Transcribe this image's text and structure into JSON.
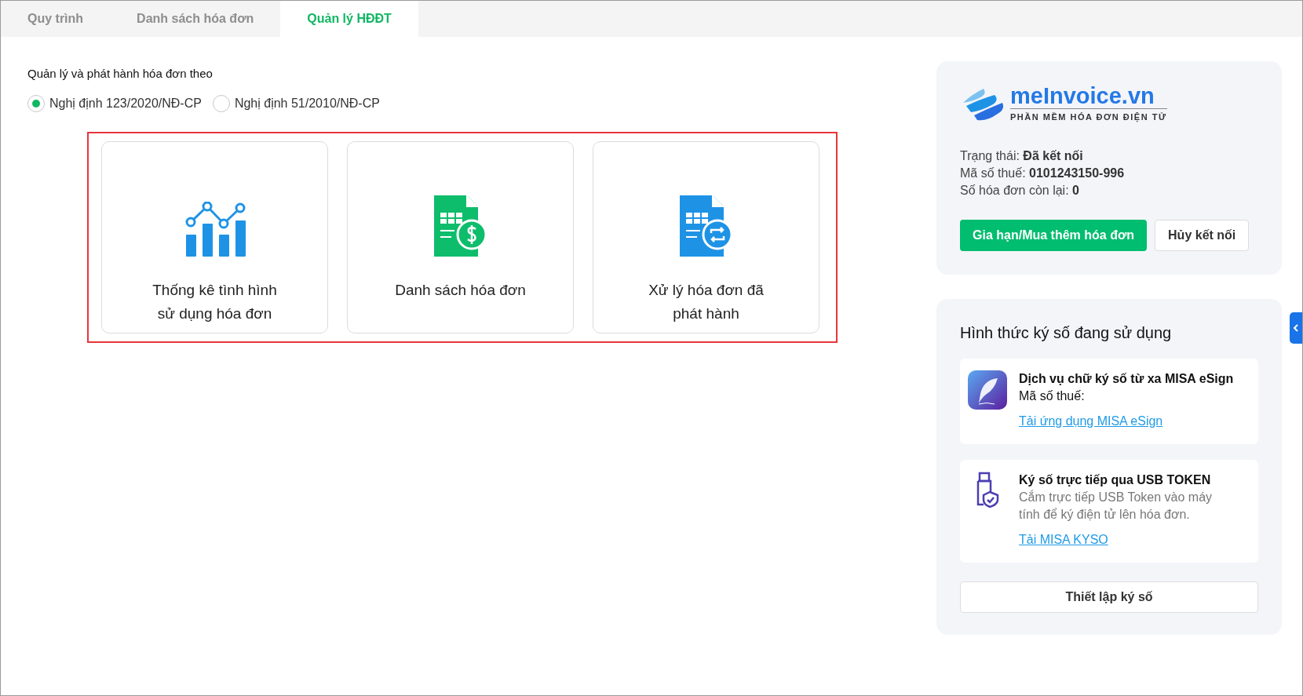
{
  "tabs": [
    {
      "label": "Quy trình",
      "selected": false
    },
    {
      "label": "Danh sách hóa đơn",
      "selected": false
    },
    {
      "label": "Quản lý HĐĐT",
      "selected": true
    }
  ],
  "decree": {
    "label": "Quản lý và phát hành hóa đơn theo",
    "options": [
      {
        "label": "Nghị định 123/2020/NĐ-CP",
        "selected": true
      },
      {
        "label": "Nghị định 51/2010/NĐ-CP",
        "selected": false
      }
    ]
  },
  "cards": [
    {
      "kind": "chart",
      "label": "Thống kê tình hình sử dụng hóa đơn"
    },
    {
      "kind": "invoice-money",
      "label": "Danh sách hóa đơn"
    },
    {
      "kind": "invoice-exchange",
      "label": "Xử lý hóa đơn đã phát hành"
    }
  ],
  "connection": {
    "logo_name": "meInvoice.vn",
    "logo_tagline": "PHẦN MỀM HÓA ĐƠN ĐIỆN TỬ",
    "fields": [
      {
        "label": "Trạng thái:",
        "value": "Đã kết nối"
      },
      {
        "label": "Mã số thuế:",
        "value": "0101243150-996"
      },
      {
        "label": "Số hóa đơn còn lại:",
        "value": "0"
      }
    ],
    "primary_button": "Gia hạn/Mua thêm hóa đơn",
    "secondary_button": "Hủy kết nối"
  },
  "signing": {
    "title": "Hình thức ký số đang sử dụng",
    "methods": [
      {
        "kind": "esign",
        "title": "Dịch vụ chữ ký số từ xa MISA eSign",
        "lines": [
          "Mã số thuế:"
        ],
        "link": "Tải ứng dụng MISA eSign"
      },
      {
        "kind": "usb",
        "title": "Ký số trực tiếp qua USB TOKEN",
        "description": "Cắm trực tiếp USB Token vào máy tính để ký điện tử lên hóa đơn.",
        "link": "Tải MISA KYSO"
      }
    ],
    "button": "Thiết lập ký số"
  }
}
